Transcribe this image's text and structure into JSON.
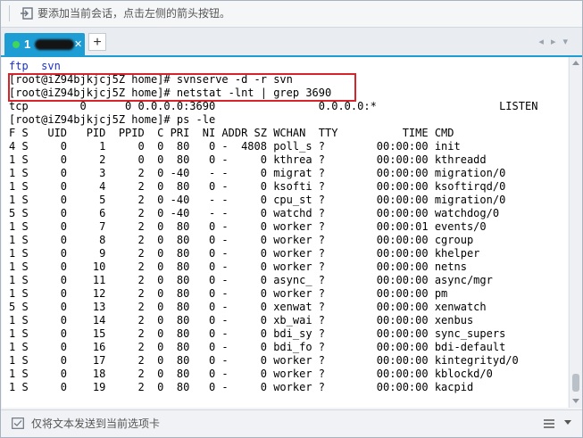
{
  "hint": {
    "text": "要添加当前会话，点击左侧的箭头按钮。",
    "icon": "arrow-into-box-icon"
  },
  "tabs": [
    {
      "number": "1",
      "status_color": "#3fd65a",
      "close_label": "✕",
      "active": true
    }
  ],
  "tabbar": {
    "add_label": "+",
    "prev_label": "◂",
    "next_label": "▸",
    "list_label": "▾"
  },
  "colors": {
    "accent": "#1e9cd4",
    "highlight_box": "#d8232a",
    "dir_listing": "#1a2fd1"
  },
  "terminal": {
    "lines": [
      {
        "text": "ftp  svn",
        "style": "blue"
      },
      {
        "text": "[root@iZ94bjkjcj5Z home]# svnserve -d -r svn",
        "style": ""
      },
      {
        "text": "[root@iZ94bjkjcj5Z home]# netstat -lnt | grep 3690",
        "style": ""
      },
      {
        "text": "tcp        0      0 0.0.0.0:3690                0.0.0.0:*                   LISTEN",
        "style": ""
      },
      {
        "text": "[root@iZ94bjkjcj5Z home]# ps -le",
        "style": ""
      },
      {
        "text": "F S   UID   PID  PPID  C PRI  NI ADDR SZ WCHAN  TTY          TIME CMD",
        "style": ""
      },
      {
        "text": "4 S     0     1     0  0  80   0 -  4808 poll_s ?        00:00:00 init",
        "style": ""
      },
      {
        "text": "1 S     0     2     0  0  80   0 -     0 kthrea ?        00:00:00 kthreadd",
        "style": ""
      },
      {
        "text": "1 S     0     3     2  0 -40   - -     0 migrat ?        00:00:00 migration/0",
        "style": ""
      },
      {
        "text": "1 S     0     4     2  0  80   0 -     0 ksofti ?        00:00:00 ksoftirqd/0",
        "style": ""
      },
      {
        "text": "1 S     0     5     2  0 -40   - -     0 cpu_st ?        00:00:00 migration/0",
        "style": ""
      },
      {
        "text": "5 S     0     6     2  0 -40   - -     0 watchd ?        00:00:00 watchdog/0",
        "style": ""
      },
      {
        "text": "1 S     0     7     2  0  80   0 -     0 worker ?        00:00:01 events/0",
        "style": ""
      },
      {
        "text": "1 S     0     8     2  0  80   0 -     0 worker ?        00:00:00 cgroup",
        "style": ""
      },
      {
        "text": "1 S     0     9     2  0  80   0 -     0 worker ?        00:00:00 khelper",
        "style": ""
      },
      {
        "text": "1 S     0    10     2  0  80   0 -     0 worker ?        00:00:00 netns",
        "style": ""
      },
      {
        "text": "1 S     0    11     2  0  80   0 -     0 async_ ?        00:00:00 async/mgr",
        "style": ""
      },
      {
        "text": "1 S     0    12     2  0  80   0 -     0 worker ?        00:00:00 pm",
        "style": ""
      },
      {
        "text": "5 S     0    13     2  0  80   0 -     0 xenwat ?        00:00:00 xenwatch",
        "style": ""
      },
      {
        "text": "1 S     0    14     2  0  80   0 -     0 xb_wai ?        00:00:00 xenbus",
        "style": ""
      },
      {
        "text": "1 S     0    15     2  0  80   0 -     0 bdi_sy ?        00:00:00 sync_supers",
        "style": ""
      },
      {
        "text": "1 S     0    16     2  0  80   0 -     0 bdi_fo ?        00:00:00 bdi-default",
        "style": ""
      },
      {
        "text": "1 S     0    17     2  0  80   0 -     0 worker ?        00:00:00 kintegrityd/0",
        "style": ""
      },
      {
        "text": "1 S     0    18     2  0  80   0 -     0 worker ?        00:00:00 kblockd/0",
        "style": ""
      },
      {
        "text": "1 S     0    19     2  0  80   0 -     0 worker ?        00:00:00 kacpid",
        "style": ""
      }
    ]
  },
  "sendbar": {
    "text": "仅将文本发送到当前选项卡",
    "menu_icon": "hamburger-menu-icon",
    "dropdown_icon": "chevron-down-icon"
  }
}
